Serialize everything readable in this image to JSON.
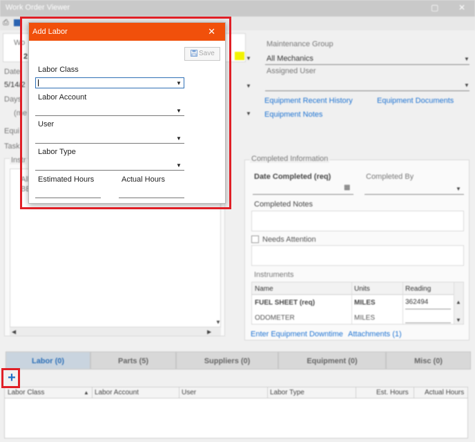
{
  "window": {
    "title": "Work Order Viewer"
  },
  "background": {
    "left_labels": [
      "Wo",
      "Date",
      "Days",
      "Equi",
      "Task",
      "Instr"
    ],
    "left_values": [
      "2",
      "5/14/2",
      "(me"
    ],
    "maintenance_group_label": "Maintenance Group",
    "maintenance_group_value": "All Mechanics",
    "assigned_user_label": "Assigned User",
    "links": {
      "recent_history": "Equipment Recent History",
      "documents": "Equipment Documents",
      "notes": "Equipment Notes",
      "downtime": "Enter Equipment Downtime",
      "attachments": "Attachments (1)"
    },
    "instructions_text": [
      "All",
      "BE"
    ],
    "completed": {
      "section": "Completed Information",
      "date_label": "Date Completed (req)",
      "by_label": "Completed By",
      "notes_label": "Completed Notes",
      "needs_attention": "Needs Attention",
      "instruments_label": "Instruments"
    },
    "instruments_table": {
      "headers": [
        "Name",
        "Units",
        "Reading"
      ],
      "rows": [
        {
          "name": "FUEL SHEET (req)",
          "units": "MILES",
          "reading": "362494"
        },
        {
          "name": "ODOMETER",
          "units": "MILES",
          "reading": ""
        }
      ]
    },
    "tabs": [
      {
        "label": "Labor  (0)"
      },
      {
        "label": "Parts  (5)"
      },
      {
        "label": "Suppliers  (0)"
      },
      {
        "label": "Equipment  (0)"
      },
      {
        "label": "Misc  (0)"
      }
    ],
    "add_button_symbol": "+",
    "grid_headers": [
      "Labor Class",
      "Labor Account",
      "User",
      "Labor Type",
      "Est. Hours",
      "Actual Hours"
    ]
  },
  "dialog": {
    "title": "Add Labor",
    "close_symbol": "✕",
    "save_label": "Save",
    "labor_class_label": "Labor Class",
    "labor_account_label": "Labor Account",
    "user_label": "User",
    "labor_type_label": "Labor Type",
    "estimated_hours_label": "Estimated Hours",
    "actual_hours_label": "Actual Hours"
  },
  "colors": {
    "dialog_header": "#f1500b",
    "highlight": "#e01f26",
    "link": "#1e73d2",
    "active_tab_text": "#2c6fb7"
  }
}
